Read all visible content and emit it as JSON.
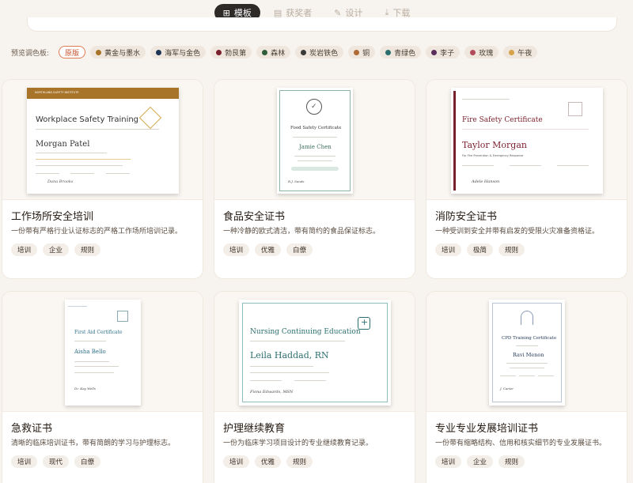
{
  "nav": {
    "tabs": [
      {
        "icon": "⊞",
        "label": "模板"
      },
      {
        "icon": "▤",
        "label": "获奖者"
      },
      {
        "icon": "✎",
        "label": "设计"
      },
      {
        "icon": "⤓",
        "label": "下载"
      }
    ]
  },
  "palette": {
    "label": "预览调色板:",
    "chips": [
      {
        "label": "原版",
        "color": ""
      },
      {
        "label": "黄金与墨水",
        "color": "#a8742a"
      },
      {
        "label": "海军与金色",
        "color": "#1f3556"
      },
      {
        "label": "勃艮第",
        "color": "#7a1f2c"
      },
      {
        "label": "森林",
        "color": "#2f5d3a"
      },
      {
        "label": "炭岩铁色",
        "color": "#3a3a3a"
      },
      {
        "label": "铜",
        "color": "#b06a35"
      },
      {
        "label": "青绿色",
        "color": "#2c6f6f"
      },
      {
        "label": "李子",
        "color": "#5b2d5c"
      },
      {
        "label": "玫瑰",
        "color": "#b24a5c"
      },
      {
        "label": "午夜",
        "color": "#d6a24a"
      }
    ]
  },
  "cards": [
    {
      "title": "工作场所安全培训",
      "desc": "一份带有严格行业认证标志的严格工作场所培训记录。",
      "tags": [
        "培训",
        "企业",
        "规则"
      ],
      "cert": {
        "header": "NORTHLAND SAFETY INSTITUTE",
        "heading": "Workplace Safety Training",
        "name": "Morgan Patel",
        "sig": "Dana Brooks",
        "accent": "#a8742a"
      }
    },
    {
      "title": "食品安全证书",
      "desc": "一种冷静的欧式清洁，带有简约的食品保证标志。",
      "tags": [
        "培训",
        "优雅",
        "白僚"
      ],
      "cert": {
        "heading": "Food Safety Certificate",
        "name": "Jamie Chen",
        "sig": "R.J. Sands",
        "accent": "#3c6d5a"
      }
    },
    {
      "title": "消防安全证书",
      "desc": "一种受训到安全并带有启发的受限火灾准备资格证。",
      "tags": [
        "培训",
        "极简",
        "规则"
      ],
      "cert": {
        "heading": "Fire Safety Certificate",
        "name": "Taylor Morgan",
        "line": "For Fire Prevention & Emergency Response",
        "sig": "Adele Hanson",
        "accent": "#7a1f2c"
      }
    },
    {
      "title": "急救证书",
      "desc": "清晰的临床培训证书，带有简朗的学习与护理标志。",
      "tags": [
        "培训",
        "现代",
        "白僚"
      ],
      "cert": {
        "heading": "First Aid Certificate",
        "name": "Aisha Bello",
        "sig": "Dr. Kay Wells",
        "accent": "#2c6f8a"
      }
    },
    {
      "title": "护理继续教育",
      "desc": "一份为临床学习项目设计的专业继续教育记录。",
      "tags": [
        "培训",
        "优雅",
        "规则"
      ],
      "cert": {
        "heading": "Nursing Continuing Education",
        "name": "Leila Haddad, RN",
        "sig": "Fiona Edwards, MSN",
        "accent": "#2c6f6f"
      }
    },
    {
      "title": "专业专业发展培训证书",
      "desc": "一份带有缩略结构、信用和核实细节的专业发展证书。",
      "tags": [
        "培训",
        "企业",
        "规则"
      ],
      "cert": {
        "heading": "CPD Training Certificate",
        "name": "Ravi Menon",
        "sig": "J. Carter",
        "accent": "#1f3556"
      }
    }
  ]
}
